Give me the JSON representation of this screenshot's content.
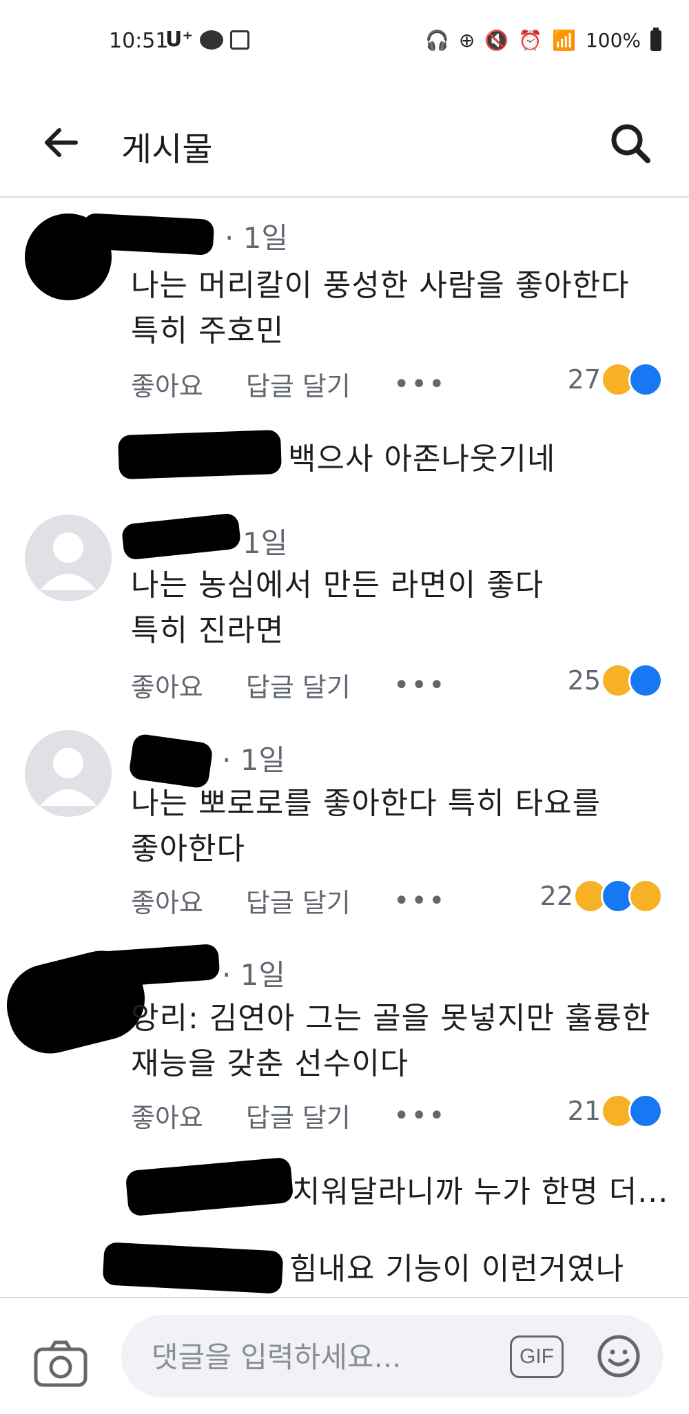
{
  "status_bar": {
    "time": "10:51",
    "carrier": "U⁺",
    "right_icons": [
      "headphones-icon",
      "data-saver-icon",
      "mute-icon",
      "alarm-icon",
      "wifi-icon",
      "signal-icon"
    ],
    "battery": "100%"
  },
  "header": {
    "title": "게시물",
    "back_icon": "back-arrow-icon",
    "search_icon": "search-icon"
  },
  "comments": [
    {
      "time": "· 1일",
      "lines": [
        "나는 머리칼이 풍성한 사람을 좋아한다",
        "특히 주호민"
      ],
      "actions": {
        "like": "좋아요",
        "reply": "답글 달기",
        "more": "•••"
      },
      "reaction_count": "27",
      "reactions": [
        "haha",
        "like"
      ],
      "replies": [
        {
          "text": "백으사 아존나웃기네"
        }
      ]
    },
    {
      "time": "1일",
      "lines": [
        "나는 농심에서 만든 라면이 좋다",
        "특히 진라면"
      ],
      "actions": {
        "like": "좋아요",
        "reply": "답글 달기",
        "more": "•••"
      },
      "reaction_count": "25",
      "reactions": [
        "haha",
        "like"
      ]
    },
    {
      "time": "· 1일",
      "lines": [
        "나는 뽀로로를 좋아한다 특히 타요를",
        "좋아한다"
      ],
      "actions": {
        "like": "좋아요",
        "reply": "답글 달기",
        "more": "•••"
      },
      "reaction_count": "22",
      "reactions": [
        "haha",
        "like",
        "care"
      ]
    },
    {
      "time": "· 1일",
      "lines": [
        "앙리: 김연아 그는 골을 못넣지만 훌륭한",
        "재능을 갖춘 선수이다"
      ],
      "actions": {
        "like": "좋아요",
        "reply": "답글 달기",
        "more": "•••"
      },
      "reaction_count": "21",
      "reactions": [
        "haha",
        "like"
      ],
      "replies": [
        {
          "text": "치워달라니까 누가 한명 더..."
        },
        {
          "text": "힘내요 기능이 이런거였나"
        }
      ]
    }
  ],
  "composer": {
    "placeholder": "댓글을 입력하세요...",
    "gif_label": "GIF",
    "camera_icon": "camera-icon",
    "emoji_icon": "emoji-icon"
  },
  "colors": {
    "like_blue": "#1877f2",
    "haha_yellow": "#f7b125",
    "meta_gray": "#606770"
  }
}
